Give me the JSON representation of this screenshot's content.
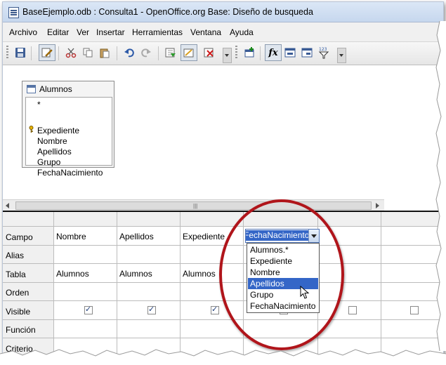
{
  "window": {
    "title": "BaseEjemplo.odb : Consulta1 - OpenOffice.org Base: Diseño de busqueda"
  },
  "menu": [
    "Archivo",
    "Editar",
    "Ver",
    "Insertar",
    "Herramientas",
    "Ventana",
    "Ayuda"
  ],
  "toolbar": {
    "buttons": [
      "save-icon",
      "edit-mode-icon",
      "cut-icon",
      "copy-icon",
      "paste-icon",
      "undo-icon",
      "redo-icon",
      "run-query-icon",
      "design-view-toggle-icon",
      "clear-query-icon",
      "add-table-icon",
      "functions-icon",
      "table-name-icon",
      "alias-icon",
      "distinct-values-icon"
    ],
    "functions_label": "fx",
    "distinct_label": "123"
  },
  "table_window": {
    "name": "Alumnos",
    "fields": [
      "*",
      "Expediente",
      "Nombre",
      "Apellidos",
      "Grupo",
      "FechaNacimiento"
    ]
  },
  "grid": {
    "row_labels": [
      "Campo",
      "Alias",
      "Tabla",
      "Orden",
      "Visible",
      "Función",
      "Criterio"
    ],
    "columns": [
      {
        "campo": "Nombre",
        "tabla": "Alumnos",
        "visible": true
      },
      {
        "campo": "Apellidos",
        "tabla": "Alumnos",
        "visible": true
      },
      {
        "campo": "Expediente",
        "tabla": "Alumnos",
        "visible": true
      },
      {
        "campo": "FechaNacimiento",
        "tabla": "",
        "visible": true
      },
      {
        "campo": "",
        "tabla": "",
        "visible": false
      },
      {
        "campo": "",
        "tabla": "",
        "visible": false
      }
    ]
  },
  "combo": {
    "value": "FechaNacimiento",
    "options": [
      "Alumnos.*",
      "Expediente",
      "Nombre",
      "Apellidos",
      "Grupo",
      "FechaNacimiento"
    ],
    "highlighted": "Apellidos"
  },
  "colors": {
    "selection": "#3466c7",
    "annotation_circle": "#b0151b"
  }
}
